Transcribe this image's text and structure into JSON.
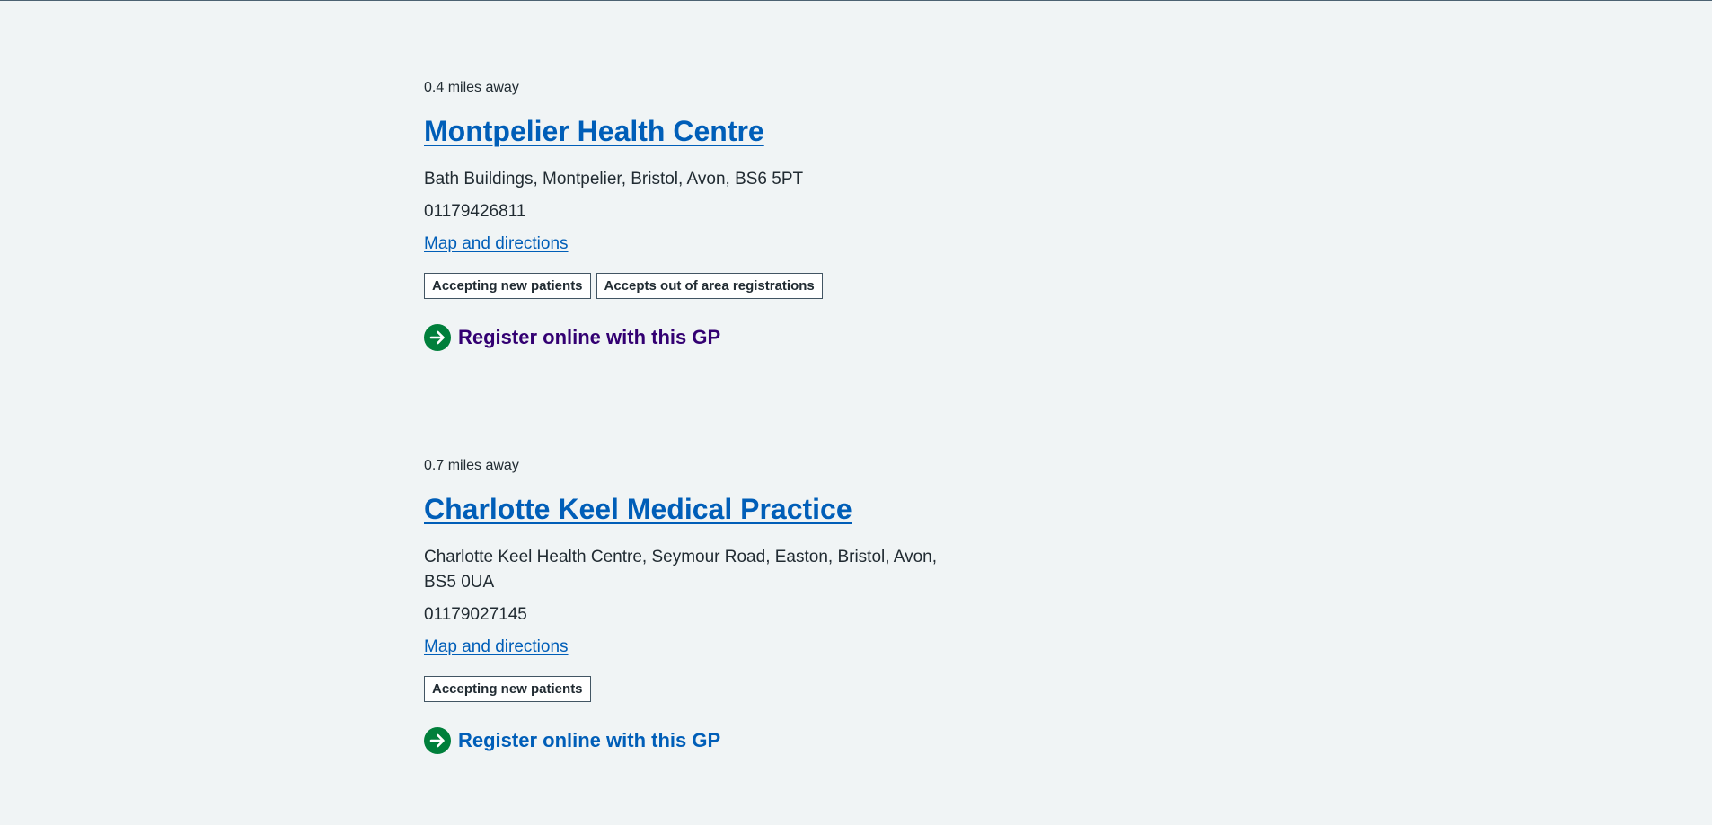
{
  "results": [
    {
      "distance": "0.4 miles away",
      "name": "Montpelier Health Centre",
      "address": "Bath Buildings, Montpelier, Bristol, Avon, BS6 5PT",
      "phone": "01179426811",
      "map_link": "Map and directions",
      "tags": [
        "Accepting new patients",
        "Accepts out of area registrations"
      ],
      "register_label": "Register online with this GP",
      "register_color": "#330072"
    },
    {
      "distance": "0.7 miles away",
      "name": "Charlotte Keel Medical Practice",
      "address": "Charlotte Keel Health Centre, Seymour Road, Easton, Bristol, Avon, BS5 0UA",
      "phone": "01179027145",
      "map_link": "Map and directions",
      "tags": [
        "Accepting new patients"
      ],
      "register_label": "Register online with this GP",
      "register_color": "#005eb8"
    }
  ],
  "icons": {
    "register": "arrow-right-circle-icon"
  },
  "colors": {
    "background": "#f0f4f5",
    "link": "#005eb8",
    "visited_link": "#330072",
    "icon_green": "#007f3b",
    "text": "#212b32"
  }
}
